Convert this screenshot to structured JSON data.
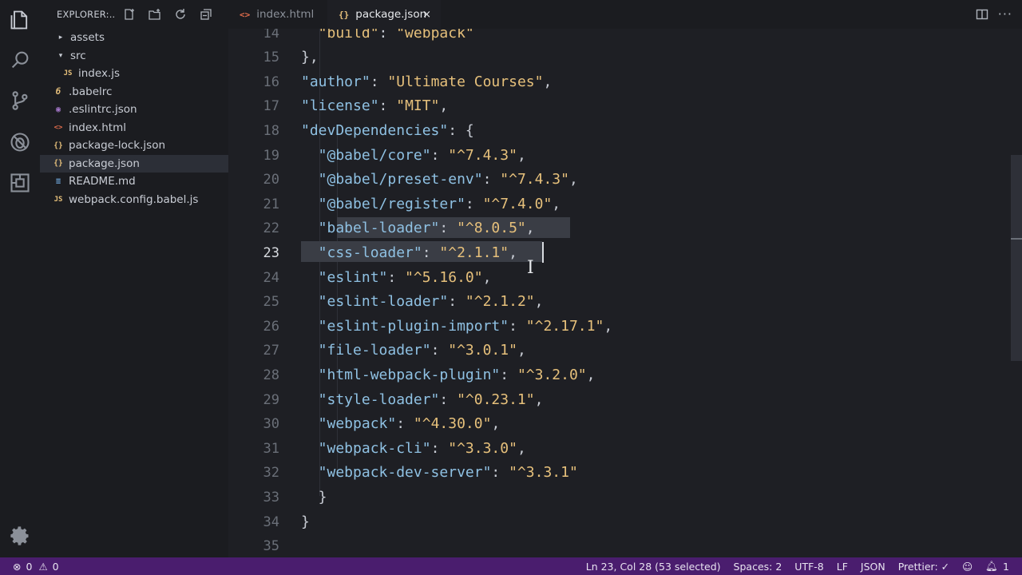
{
  "sidebar": {
    "title": "EXPLORER:...",
    "items": [
      {
        "label": "assets",
        "icon": "chevron-right-icon",
        "icon_glyph": "▸",
        "color": "#c8ccd4"
      },
      {
        "label": "src",
        "icon": "chevron-down-icon",
        "icon_glyph": "▾",
        "color": "#c8ccd4"
      },
      {
        "label": "index.js",
        "icon": "js-file-icon",
        "icon_glyph": "JS",
        "color": "#e6c07b"
      },
      {
        "label": ".babelrc",
        "icon": "babel-file-icon",
        "icon_glyph": "б",
        "color": "#e6c07b"
      },
      {
        "label": ".eslintrc.json",
        "icon": "eslint-file-icon",
        "icon_glyph": "◉",
        "color": "#a074c4"
      },
      {
        "label": "index.html",
        "icon": "html-file-icon",
        "icon_glyph": "<>",
        "color": "#e06c4b"
      },
      {
        "label": "package-lock.json",
        "icon": "json-file-icon",
        "icon_glyph": "{}",
        "color": "#e6c07b"
      },
      {
        "label": "package.json",
        "icon": "json-file-icon",
        "icon_glyph": "{}",
        "color": "#e6c07b"
      },
      {
        "label": "README.md",
        "icon": "markdown-file-icon",
        "icon_glyph": "≡",
        "color": "#6fa8dc"
      },
      {
        "label": "webpack.config.babel.js",
        "icon": "js-file-icon",
        "icon_glyph": "JS",
        "color": "#e6c07b"
      }
    ]
  },
  "tabs": [
    {
      "label": "index.html",
      "icon": "html-file-icon",
      "icon_glyph": "<>",
      "color": "#e06c4b",
      "active": false
    },
    {
      "label": "package.json",
      "icon": "json-file-icon",
      "icon_glyph": "{}",
      "color": "#e6c07b",
      "active": true,
      "close": "×"
    }
  ],
  "editor": {
    "lines": [
      {
        "n": "14",
        "indent": "  ",
        "tokens": [
          [
            "s",
            "\"build\""
          ],
          [
            "p",
            ": "
          ],
          [
            "s",
            "\"webpack\""
          ]
        ]
      },
      {
        "n": "15",
        "indent": "",
        "tokens": [
          [
            "p",
            "},"
          ]
        ]
      },
      {
        "n": "16",
        "indent": "",
        "tokens": [
          [
            "k",
            "\"author\""
          ],
          [
            "p",
            ": "
          ],
          [
            "s",
            "\"Ultimate Courses\""
          ],
          [
            "p",
            ","
          ]
        ]
      },
      {
        "n": "17",
        "indent": "",
        "tokens": [
          [
            "k",
            "\"license\""
          ],
          [
            "p",
            ": "
          ],
          [
            "s",
            "\"MIT\""
          ],
          [
            "p",
            ","
          ]
        ]
      },
      {
        "n": "18",
        "indent": "",
        "tokens": [
          [
            "k",
            "\"devDependencies\""
          ],
          [
            "p",
            ": {"
          ]
        ]
      },
      {
        "n": "19",
        "indent": "  ",
        "tokens": [
          [
            "k",
            "\"@babel/core\""
          ],
          [
            "p",
            ": "
          ],
          [
            "s",
            "\"^7.4.3\""
          ],
          [
            "p",
            ","
          ]
        ]
      },
      {
        "n": "20",
        "indent": "  ",
        "tokens": [
          [
            "k",
            "\"@babel/preset-env\""
          ],
          [
            "p",
            ": "
          ],
          [
            "s",
            "\"^7.4.3\""
          ],
          [
            "p",
            ","
          ]
        ]
      },
      {
        "n": "21",
        "indent": "  ",
        "tokens": [
          [
            "k",
            "\"@babel/register\""
          ],
          [
            "p",
            ": "
          ],
          [
            "s",
            "\"^7.4.0\""
          ],
          [
            "p",
            ","
          ]
        ]
      },
      {
        "n": "22",
        "indent": "  ",
        "tokens": [
          [
            "k",
            "\"babel-loader\""
          ],
          [
            "p",
            ": "
          ],
          [
            "s",
            "\"^8.0.5\""
          ],
          [
            "p",
            ","
          ]
        ]
      },
      {
        "n": "23",
        "indent": "  ",
        "tokens": [
          [
            "k",
            "\"css-loader\""
          ],
          [
            "p",
            ": "
          ],
          [
            "s",
            "\"^2.1.1\""
          ],
          [
            "p",
            ","
          ]
        ]
      },
      {
        "n": "24",
        "indent": "  ",
        "tokens": [
          [
            "k",
            "\"eslint\""
          ],
          [
            "p",
            ": "
          ],
          [
            "s",
            "\"^5.16.0\""
          ],
          [
            "p",
            ","
          ]
        ]
      },
      {
        "n": "25",
        "indent": "  ",
        "tokens": [
          [
            "k",
            "\"eslint-loader\""
          ],
          [
            "p",
            ": "
          ],
          [
            "s",
            "\"^2.1.2\""
          ],
          [
            "p",
            ","
          ]
        ]
      },
      {
        "n": "26",
        "indent": "  ",
        "tokens": [
          [
            "k",
            "\"eslint-plugin-import\""
          ],
          [
            "p",
            ": "
          ],
          [
            "s",
            "\"^2.17.1\""
          ],
          [
            "p",
            ","
          ]
        ]
      },
      {
        "n": "27",
        "indent": "  ",
        "tokens": [
          [
            "k",
            "\"file-loader\""
          ],
          [
            "p",
            ": "
          ],
          [
            "s",
            "\"^3.0.1\""
          ],
          [
            "p",
            ","
          ]
        ]
      },
      {
        "n": "28",
        "indent": "  ",
        "tokens": [
          [
            "k",
            "\"html-webpack-plugin\""
          ],
          [
            "p",
            ": "
          ],
          [
            "s",
            "\"^3.2.0\""
          ],
          [
            "p",
            ","
          ]
        ]
      },
      {
        "n": "29",
        "indent": "  ",
        "tokens": [
          [
            "k",
            "\"style-loader\""
          ],
          [
            "p",
            ": "
          ],
          [
            "s",
            "\"^0.23.1\""
          ],
          [
            "p",
            ","
          ]
        ]
      },
      {
        "n": "30",
        "indent": "  ",
        "tokens": [
          [
            "k",
            "\"webpack\""
          ],
          [
            "p",
            ": "
          ],
          [
            "s",
            "\"^4.30.0\""
          ],
          [
            "p",
            ","
          ]
        ]
      },
      {
        "n": "31",
        "indent": "  ",
        "tokens": [
          [
            "k",
            "\"webpack-cli\""
          ],
          [
            "p",
            ": "
          ],
          [
            "s",
            "\"^3.3.0\""
          ],
          [
            "p",
            ","
          ]
        ]
      },
      {
        "n": "32",
        "indent": "  ",
        "tokens": [
          [
            "k",
            "\"webpack-dev-server\""
          ],
          [
            "p",
            ": "
          ],
          [
            "s",
            "\"^3.3.1\""
          ]
        ]
      },
      {
        "n": "33",
        "indent": "  ",
        "tokens": [
          [
            "p",
            "}"
          ]
        ]
      },
      {
        "n": "34",
        "indent": "",
        "tokens": [
          [
            "p",
            "}"
          ]
        ]
      },
      {
        "n": "35",
        "indent": "",
        "tokens": []
      }
    ],
    "current_line": "23"
  },
  "statusbar": {
    "errors": "0",
    "warnings": "0",
    "position": "Ln 23, Col 28 (53 selected)",
    "spaces": "Spaces: 2",
    "encoding": "UTF-8",
    "eol": "LF",
    "language": "JSON",
    "prettier": "Prettier: ✓",
    "notifications": "1"
  },
  "colors": {
    "key": "#8fc1e3",
    "string": "#e6c07b",
    "statusbar": "#4a1d6e"
  }
}
